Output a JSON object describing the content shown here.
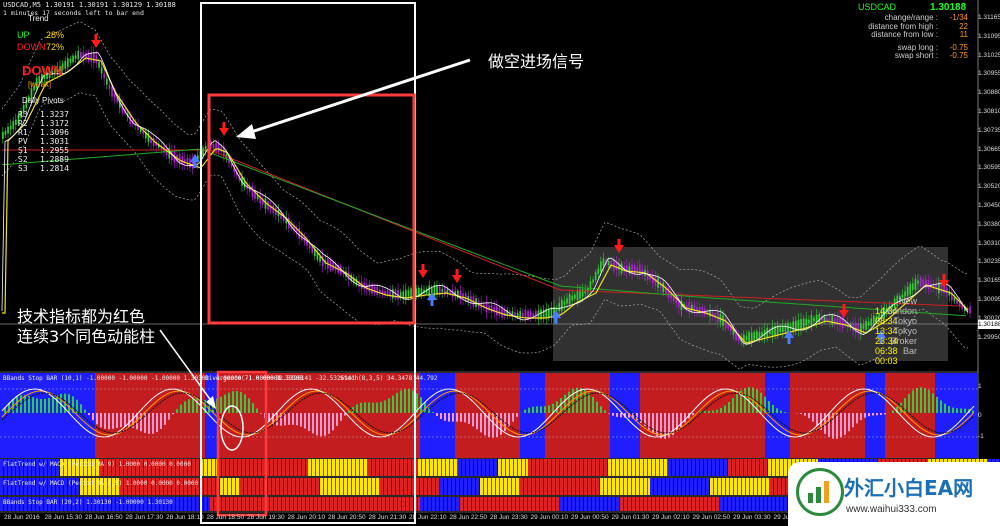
{
  "chart": {
    "header_symbol_line": "USDCAD,M5  1.30191 1.30191 1.30129 1.30188",
    "header_timer_line": "1 minutes 17 seconds left to bar end",
    "trend_label": "Trend",
    "up_label": "UP",
    "up_value": "28%",
    "down_label": "DOWN",
    "down_value": "72%",
    "signal_big": "DOWN",
    "signal_sub": "[weak]",
    "pivots_title": "Daily Pivots",
    "pivots": [
      {
        "name": "R3",
        "value": "1.3237"
      },
      {
        "name": "R2",
        "value": "1.3172"
      },
      {
        "name": "R1",
        "value": "1.3096"
      },
      {
        "name": "PV",
        "value": "1.3031"
      },
      {
        "name": "S1",
        "value": "1.2955"
      },
      {
        "name": "S2",
        "value": "1.2889"
      },
      {
        "name": "S3",
        "value": "1.2814"
      }
    ],
    "current_price": "1.30188"
  },
  "stats_panel": {
    "symbol": "USDCAD",
    "price": "1.30188",
    "rows": [
      {
        "label": "change/range",
        "value": "-1/34"
      },
      {
        "label": "distance from high",
        "value": "22"
      },
      {
        "label": "distance from low",
        "value": "11"
      },
      {
        "label": "swap long",
        "value": "-0.75"
      },
      {
        "label": "swap short",
        "value": "-0.75"
      }
    ]
  },
  "sessions": [
    {
      "label": "New",
      "value": "14:34"
    },
    {
      "label": "London",
      "value": "08:34"
    },
    {
      "label": "Tokyo",
      "value": "13:34"
    },
    {
      "label": "Tokyo",
      "value": "23:34"
    },
    {
      "label": "Broker",
      "value": "06:38"
    },
    {
      "label": "Bar",
      "value": "00:03"
    }
  ],
  "y_axis": [
    "1.31165",
    "1.31095",
    "1.31025",
    "1.30955",
    "1.30880",
    "1.30810",
    "1.30735",
    "1.30665",
    "1.30595",
    "1.30520",
    "1.30450",
    "1.30380",
    "1.30310",
    "1.30235",
    "1.30165",
    "1.30095",
    "1.30020",
    "1.29950"
  ],
  "indicators": {
    "bbands_label": "BBands Stop BAR (10,1) -1.00000 -1.00000 -1.00000 1.30308 -1.00000 -1.00000 1.30308",
    "divergence_label": "Divergence(7) 0.00000",
    "values_label": "-32.5326141 -32.5326141",
    "stoch_label": "Stoch(8,3,5) 34.3478 44.792",
    "osc_levels": [
      "1",
      "0",
      "-1"
    ],
    "flat1_label": "FlatTrend w/ MACD (Period_MA 9) 1.0000 0.0000 0.0000",
    "flat2_label": "FlatTrend w/ MACD (Period_MA 3,5) 1.0000 0.0000 0.0000",
    "flat3_label": "BBands Stop BAR (20,2) 1.30130 -1.00000 1.30130",
    "strip_scale": [
      "1",
      "1",
      "1"
    ]
  },
  "x_axis": [
    "28 Jun 2016",
    "28 Jun 15:30",
    "28 Jun 16:50",
    "28 Jun 17:30",
    "28 Jun 18:10",
    "28 Jun 18:50",
    "28 Jun 19:30",
    "28 Jun 20:10",
    "28 Jun 20:50",
    "28 Jun 21:30",
    "28 Jun 22:10",
    "28 Jun 22:50",
    "28 Jun 23:30",
    "29 Jun 00:10",
    "29 Jun 00:50",
    "29 Jun 01:30",
    "29 Jun 02:10",
    "29 Jun 02:50",
    "29 Jun 03:30",
    "29 Jun 04:10",
    "29 Jun 04:50"
  ],
  "annotations": {
    "short_entry": "做空进场信号",
    "tech_line1": "技术指标都为红色",
    "tech_line2": "连续3个同色动能柱"
  },
  "watermark": {
    "brand": "外汇小白EA网",
    "url": "www.waihui333.com"
  },
  "colors": {
    "up": "#1aff1a",
    "down": "#ff2020",
    "bull_bar": "#1e1eff",
    "bear_bar": "#c41d20",
    "neutral_bar": "#ffe600",
    "candle_bull": "#33cc33",
    "candle_bear": "#aa22cc",
    "ma_red": "#d02020",
    "ma_green": "#22aa22",
    "highlight": "#ff3b3b"
  }
}
